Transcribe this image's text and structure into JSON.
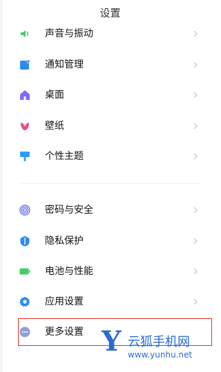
{
  "header": {
    "title": "设置"
  },
  "groups": [
    {
      "items": [
        {
          "label": "声音与振动",
          "icon": "speaker-icon",
          "color": "#3fcf6a"
        },
        {
          "label": "通知管理",
          "icon": "notification-icon",
          "color": "#2a8cf0"
        },
        {
          "label": "桌面",
          "icon": "home-icon",
          "color": "#7b6cf6"
        },
        {
          "label": "壁纸",
          "icon": "tulip-icon",
          "color": "#ef4a78"
        },
        {
          "label": "个性主题",
          "icon": "brush-icon",
          "color": "#2f9bf5"
        }
      ]
    },
    {
      "items": [
        {
          "label": "密码与安全",
          "icon": "fingerprint-icon",
          "color": "#6a6ff0"
        },
        {
          "label": "隐私保护",
          "icon": "shield-icon",
          "color": "#2a8cf0"
        },
        {
          "label": "电池与性能",
          "icon": "battery-icon",
          "color": "#3fcf6a"
        },
        {
          "label": "应用设置",
          "icon": "gear-icon",
          "color": "#2a8cf0"
        },
        {
          "label": "更多设置",
          "icon": "more-icon",
          "color": "#8f9fda"
        }
      ]
    }
  ],
  "watermark": {
    "letter": "Y",
    "name": "云狐手机网",
    "url": "www.yunhu.net",
    "color": "#2a6bd1"
  },
  "highlight_color": "#e0312a"
}
